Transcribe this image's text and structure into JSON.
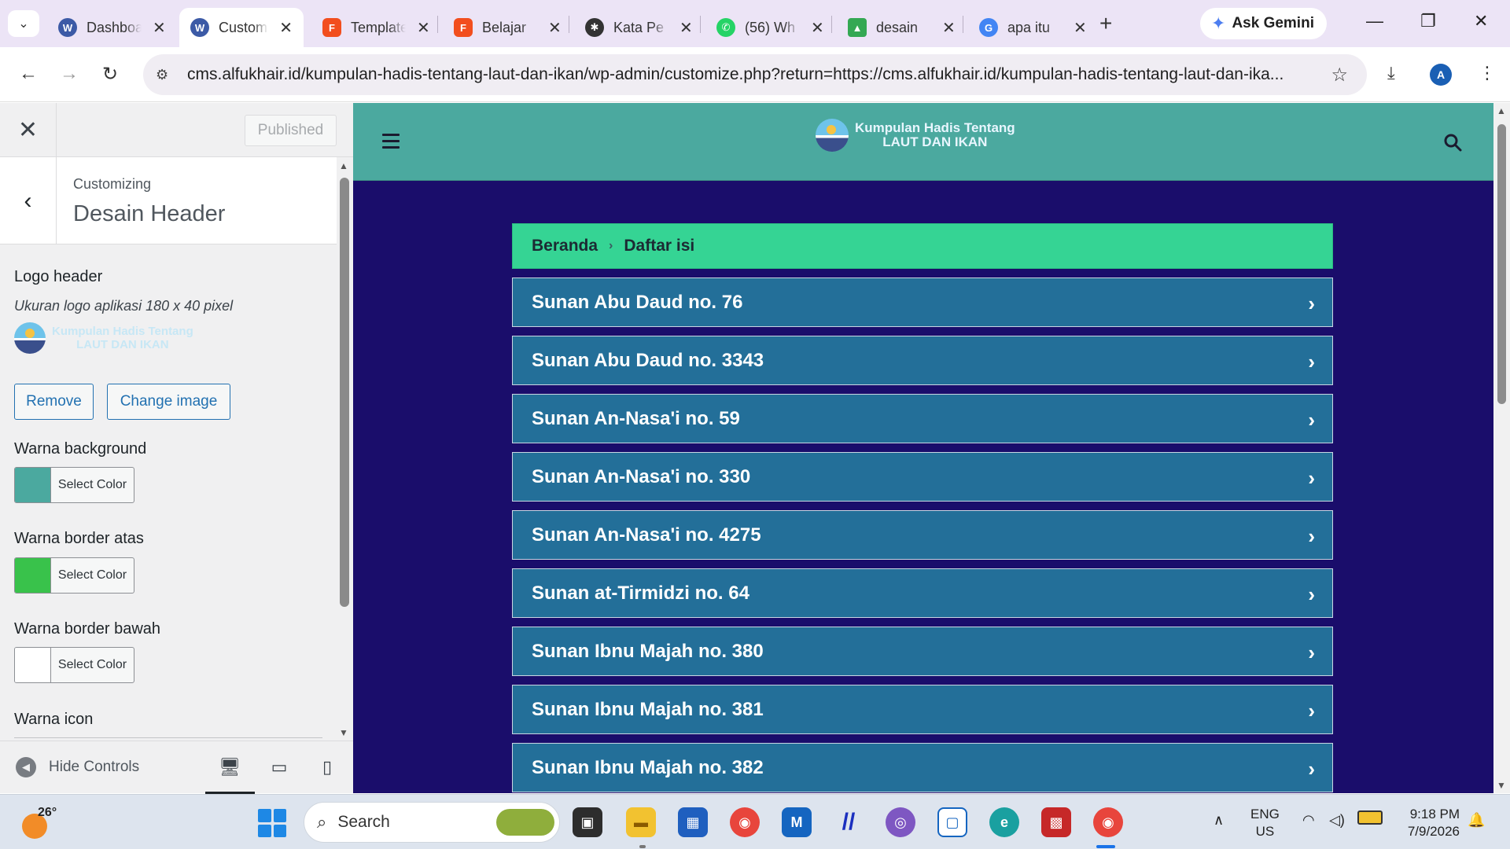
{
  "browser": {
    "tabs": [
      {
        "title": "Dashboard",
        "favicon": "wordpress-icon",
        "color": "#3c5aa6",
        "active": false
      },
      {
        "title": "Customize",
        "favicon": "wordpress-icon",
        "color": "#3c5aa6",
        "active": true
      },
      {
        "title": "Template",
        "favicon": "figma-icon",
        "color": "#f24e1e",
        "active": false
      },
      {
        "title": "Belajar",
        "favicon": "figma-icon",
        "color": "#f24e1e",
        "active": false
      },
      {
        "title": "Kata Pe",
        "favicon": "chatgpt-icon",
        "color": "#333333",
        "active": false
      },
      {
        "title": "(56) Wh",
        "favicon": "whatsapp-icon",
        "color": "#25d366",
        "active": false
      },
      {
        "title": "desain",
        "favicon": "drive-icon",
        "color": "#34a853",
        "active": false
      },
      {
        "title": "apa itu",
        "favicon": "google-icon",
        "color": "#4285f4",
        "active": false
      }
    ],
    "gemini_label": "Ask Gemini",
    "url": "cms.alfukhair.id/kumpulan-hadis-tentang-laut-dan-ikan/wp-admin/customize.php?return=https://cms.alfukhair.id/kumpulan-hadis-tentang-laut-dan-ika...",
    "profile_initial": "A"
  },
  "customizer": {
    "published_label": "Published",
    "customizing_label": "Customizing",
    "section_title": "Desain Header",
    "logo_label": "Logo header",
    "logo_description": "Ukuran logo aplikasi 180 x 40 pixel",
    "logo_text_line1": "Kumpulan Hadis Tentang",
    "logo_text_line2": "LAUT DAN IKAN",
    "remove_label": "Remove",
    "change_image_label": "Change image",
    "controls": [
      {
        "label": "Warna background",
        "button": "Select Color",
        "color": "#4ba99f"
      },
      {
        "label": "Warna border atas",
        "button": "Select Color",
        "color": "#39c24b"
      },
      {
        "label": "Warna border bawah",
        "button": "Select Color",
        "color": "#ffffff"
      }
    ],
    "icon_color_label": "Warna icon",
    "hide_controls_label": "Hide Controls"
  },
  "preview": {
    "header_bg": "#4ba99f",
    "page_bg": "#1a0d6b",
    "logo_line1": "Kumpulan Hadis Tentang",
    "logo_line2": "LAUT DAN IKAN",
    "breadcrumb": [
      "Beranda",
      "Daftar isi"
    ],
    "items": [
      "Sunan Abu Daud no. 76",
      "Sunan Abu Daud no. 3343",
      "Sunan An-Nasa'i no. 59",
      "Sunan An-Nasa'i no. 330",
      "Sunan An-Nasa'i no. 4275",
      "Sunan at-Tirmidzi no. 64",
      "Sunan Ibnu Majah no. 380",
      "Sunan Ibnu Majah no. 381",
      "Sunan Ibnu Majah no. 382"
    ]
  },
  "taskbar": {
    "temperature": "26°",
    "search_label": "Search",
    "lang_line1": "ENG",
    "lang_line2": "US",
    "time": "9:18 PM",
    "date": "7/9/2026"
  }
}
